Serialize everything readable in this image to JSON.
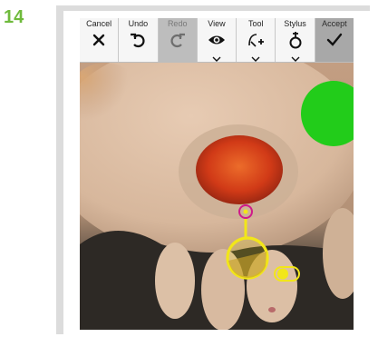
{
  "step": {
    "number": "14"
  },
  "toolbar": {
    "buttons": [
      {
        "label": "Cancel",
        "icon": "close-icon"
      },
      {
        "label": "Undo",
        "icon": "undo-icon"
      },
      {
        "label": "Redo",
        "icon": "redo-icon",
        "state": "disabled"
      },
      {
        "label": "View",
        "icon": "eye-icon",
        "dropdown": true
      },
      {
        "label": "Tool",
        "icon": "tool-icon",
        "dropdown": true
      },
      {
        "label": "Stylus",
        "icon": "stylus-icon",
        "dropdown": true
      },
      {
        "label": "Accept",
        "icon": "check-icon",
        "state": "highlighted"
      }
    ]
  },
  "colors": {
    "step_number": "#6fba3c",
    "annotation": "#f2e619",
    "probe_marker": "#d01a8a",
    "status_dot": "#22cc1a",
    "toggle": "#f2e619"
  }
}
